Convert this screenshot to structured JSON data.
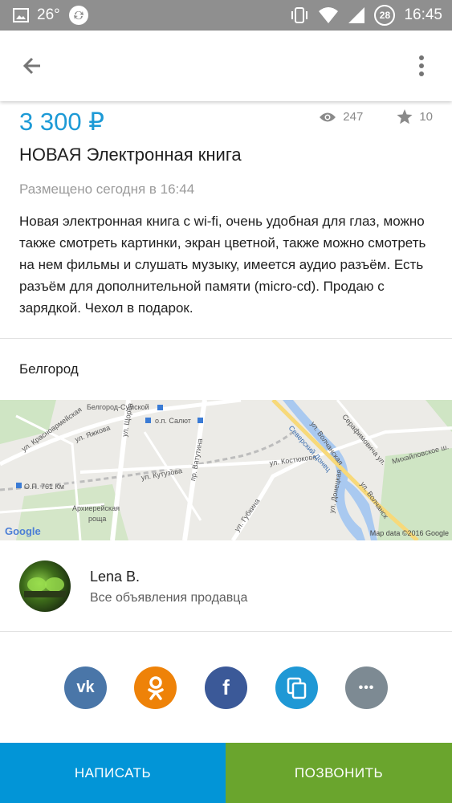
{
  "status_bar": {
    "temperature": "26°",
    "notification_count": "28",
    "time": "16:45"
  },
  "listing": {
    "price": "3 300 ₽",
    "views": "247",
    "favorites": "10",
    "title": "НОВАЯ Электронная книга",
    "posted": "Размещено сегодня в 16:44",
    "description": "Новая электронная книга с wi-fi, очень удобная для глаз, можно также смотреть картинки, экран цветной, также можно смотреть на нем фильмы и слушать музыку, имеется аудио разъём. Есть разъём для дополнительной памяти (micro-cd). Продаю с зарядкой.  Чехол в подарок.",
    "city": "Белгород"
  },
  "map": {
    "labels": {
      "station": "Белгород-Сумской",
      "stop_salyut": "о.п. Салют",
      "stop_761": "О.П. 761 Км",
      "krasnoarm": "ул. Красноармейская",
      "shorsa": "ул. Щорса",
      "lyazhkova": "ул. Яжкова",
      "vatutina": "пр. Ватутина",
      "kutuzova": "ул. Кутузова",
      "kostyukova": "ул. Костюкова",
      "gubkina": "ул. Губкина",
      "volchanskaya": "ул. Волчанская",
      "volchansk2": "ул. Волчанск",
      "severskiy": "Северский Донец",
      "dolzhikova": "ул. Донецкая",
      "arkh": "Архиерейская",
      "roscha": "роща",
      "mikh": "Михайловское ш.",
      "serafimov": "Серафимовича ул."
    },
    "google_label": "Google",
    "attribution": "Map data ©2016 Google"
  },
  "seller": {
    "name": "Lena B.",
    "all_listings": "Все объявления продавца"
  },
  "share": {
    "vk": "vk",
    "ok": "ok-icon",
    "fb": "f",
    "copy": "copy-icon",
    "more": "•••"
  },
  "actions": {
    "write": "НАПИСАТЬ",
    "call": "ПОЗВОНИТЬ"
  },
  "colors": {
    "accent": "#1d9ad6",
    "vk": "#4a76a8",
    "ok": "#ee8208",
    "fb": "#3b5998",
    "copy": "#1f98d5",
    "more": "#7d8a93",
    "write_btn": "#0295d7",
    "call_btn": "#6aa52d"
  }
}
